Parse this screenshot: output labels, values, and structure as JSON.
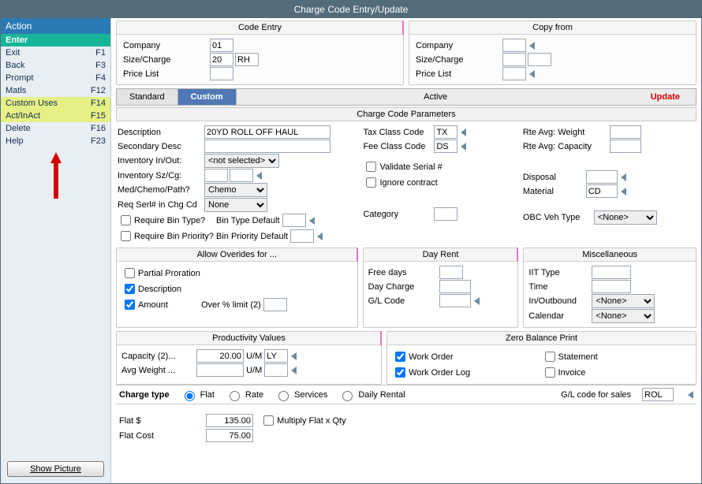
{
  "title": "Charge Code Entry/Update",
  "sidebar": {
    "header": "Action",
    "items": [
      {
        "label": "Enter",
        "key": ""
      },
      {
        "label": "Exit",
        "key": "F1"
      },
      {
        "label": "Back",
        "key": "F3"
      },
      {
        "label": "Prompt",
        "key": "F4"
      },
      {
        "label": "Matls",
        "key": "F12"
      },
      {
        "label": "Custom Uses",
        "key": "F14"
      },
      {
        "label": "Act/InAct",
        "key": "F15"
      },
      {
        "label": "Delete",
        "key": "F16"
      },
      {
        "label": "Help",
        "key": "F23"
      }
    ],
    "show_picture": "Show Picture"
  },
  "code_entry": {
    "title": "Code Entry",
    "company_label": "Company",
    "company": "01",
    "size_label": "Size/Charge",
    "size": "20",
    "charge": "RH",
    "price_label": "Price List",
    "price": ""
  },
  "copy_from": {
    "title": "Copy from",
    "company_label": "Company",
    "company": "",
    "size_label": "Size/Charge",
    "size": "",
    "charge": "",
    "price_label": "Price List",
    "price": ""
  },
  "tabs": {
    "standard": "Standard",
    "custom": "Custom",
    "active": "Active",
    "mode": "Update"
  },
  "params": {
    "title": "Charge Code Parameters",
    "description_label": "Description",
    "description": "20YD ROLL OFF HAUL",
    "secondary_label": "Secondary Desc",
    "secondary": "",
    "inventory_label": "Inventory In/Out:",
    "inventory_sel": "<not selected>",
    "invszcg_label": "Inventory Sz/Cg:",
    "invsz": "",
    "invcg": "",
    "med_label": "Med/Chemo/Path?",
    "med_sel": "Chemo",
    "req_label": "Req Serl# in Chg Cd",
    "req_sel": "None",
    "reqbin_label": "Require Bin Type?",
    "bintype_label": "Bin Type Default",
    "bintype": "",
    "reqbinprio_label": "Require Bin Priority?",
    "binprio_label": "Bin Priority Default",
    "binprio": "",
    "tax_label": "Tax Class Code",
    "tax": "TX",
    "fee_label": "Fee Class Code",
    "fee": "DS",
    "validate_label": "Validate Serial #",
    "ignore_label": "Ignore contract",
    "category_label": "Category",
    "category": "",
    "rte_w_label": "Rte Avg: Weight",
    "rte_w": "",
    "rte_c_label": "Rte Avg: Capacity",
    "rte_c": "",
    "disposal_label": "Disposal",
    "disposal": "",
    "material_label": "Material",
    "material": "CD",
    "obc_label": "OBC Veh Type",
    "obc_sel": "<None>"
  },
  "overrides": {
    "title": "Allow Overides for ...",
    "partial": "Partial Proration",
    "desc": "Description",
    "amount": "Amount",
    "overpct_label": "Over % limit (2)",
    "overpct": ""
  },
  "dayrent": {
    "title": "Day Rent",
    "free_label": "Free days",
    "free": "",
    "charge_label": "Day Charge",
    "charge": "",
    "gl_label": "G/L Code",
    "gl": ""
  },
  "misc": {
    "title": "Miscellaneous",
    "iit_label": "IIT Type",
    "iit": "",
    "time_label": "Time",
    "time": "",
    "inout_label": "In/Outbound",
    "inout_sel": "<None>",
    "cal_label": "Calendar",
    "cal_sel": "<None>"
  },
  "prod": {
    "title": "Productivity Values",
    "capacity_label": "Capacity  (2)...",
    "capacity": "20.00",
    "avg_label": "Avg Weight  ...",
    "avg": "",
    "um_label": "U/M",
    "um1": "LY",
    "um2": ""
  },
  "zero": {
    "title": "Zero Balance Print",
    "work_order": "Work Order",
    "work_order_log": "Work Order Log",
    "statement": "Statement",
    "invoice": "Invoice"
  },
  "ctype": {
    "label": "Charge type",
    "flat": "Flat",
    "rate": "Rate",
    "services": "Services",
    "daily": "Daily Rental",
    "gl_sales_label": "G/L code for sales",
    "gl_sales": "ROL"
  },
  "flat": {
    "flat_label": "Flat $",
    "flat": "135.00",
    "cost_label": "Flat Cost",
    "cost": "75.00",
    "mult_label": "Multiply Flat x Qty"
  }
}
